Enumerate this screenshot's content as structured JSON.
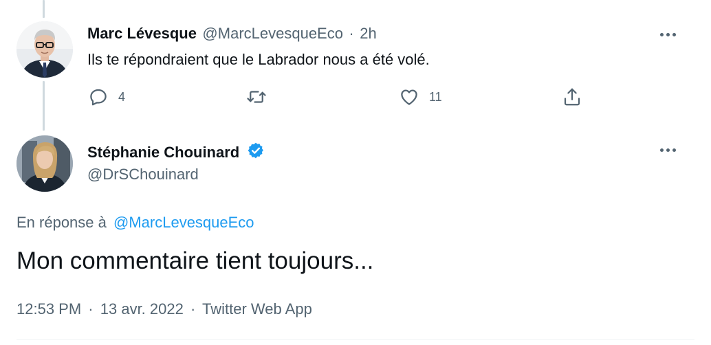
{
  "reply_tweet": {
    "author_name": "Marc Lévesque",
    "author_handle": "@MarcLevesqueEco",
    "separator": "·",
    "time_ago": "2h",
    "text": "Ils te répondraient que le Labrador nous a été volé.",
    "reply_count": "4",
    "retweet_count": "",
    "like_count": "11"
  },
  "main_tweet": {
    "author_name": "Stéphanie Chouinard",
    "author_handle": "@DrSChouinard",
    "verified": true,
    "reply_prefix": "En réponse à",
    "reply_to_handle": "@MarcLevesqueEco",
    "text": "Mon commentaire tient toujours...",
    "time": "12:53 PM",
    "date": "13 avr. 2022",
    "source": "Twitter Web App",
    "separator": "·"
  },
  "colors": {
    "link": "#1d9bf0",
    "secondary_text": "#536471",
    "thread_line": "#cfd9de",
    "divider": "#eff3f4"
  },
  "icons": [
    "more-icon",
    "reply-icon",
    "retweet-icon",
    "like-icon",
    "share-icon",
    "verified-badge-icon"
  ]
}
